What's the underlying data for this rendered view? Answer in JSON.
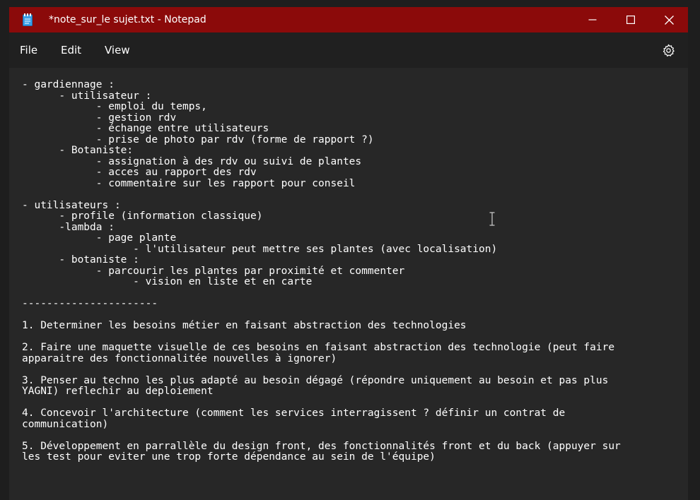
{
  "window": {
    "title": "*note_sur_le sujet.txt - Notepad",
    "title_bar_color": "#8b0a0a"
  },
  "icons": {
    "app": "notepad-icon",
    "minimize": "minimize-icon",
    "maximize": "maximize-icon",
    "close": "close-icon",
    "settings": "gear-icon",
    "cursor": "text-cursor-icon"
  },
  "menu": {
    "file": "File",
    "edit": "Edit",
    "view": "View"
  },
  "editor": {
    "content": "- gardiennage :\n      - utilisateur :\n            - emploi du temps,\n            - gestion rdv\n            - échange entre utilisateurs\n            - prise de photo par rdv (forme de rapport ?)\n      - Botaniste:\n            - assignation à des rdv ou suivi de plantes\n            - acces au rapport des rdv\n            - commentaire sur les rapport pour conseil\n\n- utilisateurs :\n      - profile (information classique)\n      -lambda :\n            - page plante\n                  - l'utilisateur peut mettre ses plantes (avec localisation)\n      - botaniste :\n            - parcourir les plantes par proximité et commenter\n                  - vision en liste et en carte\n\n----------------------\n\n1. Determiner les besoins métier en faisant abstraction des technologies\n\n2. Faire une maquette visuelle de ces besoins en faisant abstraction des technologie (peut faire\napparaitre des fonctionnalitée nouvelles à ignorer)\n\n3. Penser au techno les plus adapté au besoin dégagé (répondre uniquement au besoin et pas plus\nYAGNI) reflechir au deploiement\n\n4. Concevoir l'architecture (comment les services interragissent ? définir un contrat de\ncommunication)\n\n5. Développement en parrallèle du design front, des fonctionnalités front et du back (appuyer sur\nles test pour eviter une trop forte dépendance au sein de l'équipe)"
  }
}
